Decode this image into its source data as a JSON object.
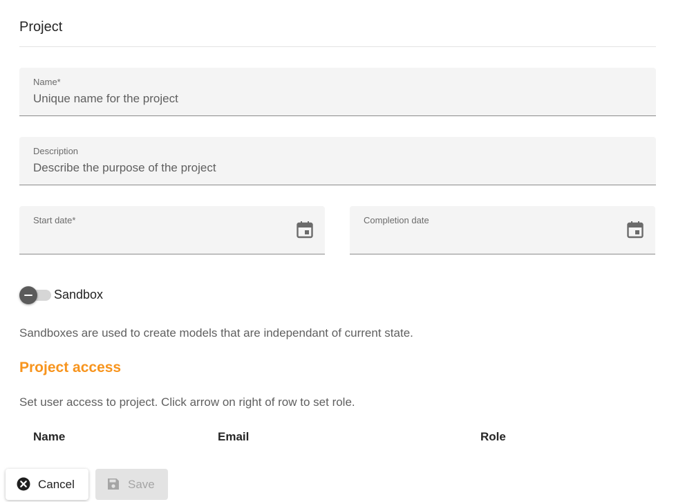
{
  "header": {
    "title": "Project"
  },
  "form": {
    "name": {
      "label": "Name*",
      "placeholder": "Unique name for the project"
    },
    "description": {
      "label": "Description",
      "placeholder": "Describe the purpose of the project"
    },
    "start_date": {
      "label": "Start date*",
      "icon": "calendar-icon"
    },
    "completion_date": {
      "label": "Completion date",
      "icon": "calendar-icon"
    },
    "sandbox": {
      "label": "Sandbox",
      "enabled": false,
      "help": "Sandboxes are used to create models that are independant of current state."
    }
  },
  "access": {
    "title": "Project access",
    "help": "Set user access to project. Click arrow on right of row to set role.",
    "columns": [
      "Name",
      "Email",
      "Role"
    ]
  },
  "actions": {
    "cancel_label": "Cancel",
    "cancel_icon": "cancel-circle-icon",
    "save_label": "Save",
    "save_icon": "save-icon",
    "save_enabled": false
  },
  "colors": {
    "accent": "#f7941d",
    "field_bg": "#f4f4f4",
    "disabled_bg": "#e3e3e3"
  }
}
